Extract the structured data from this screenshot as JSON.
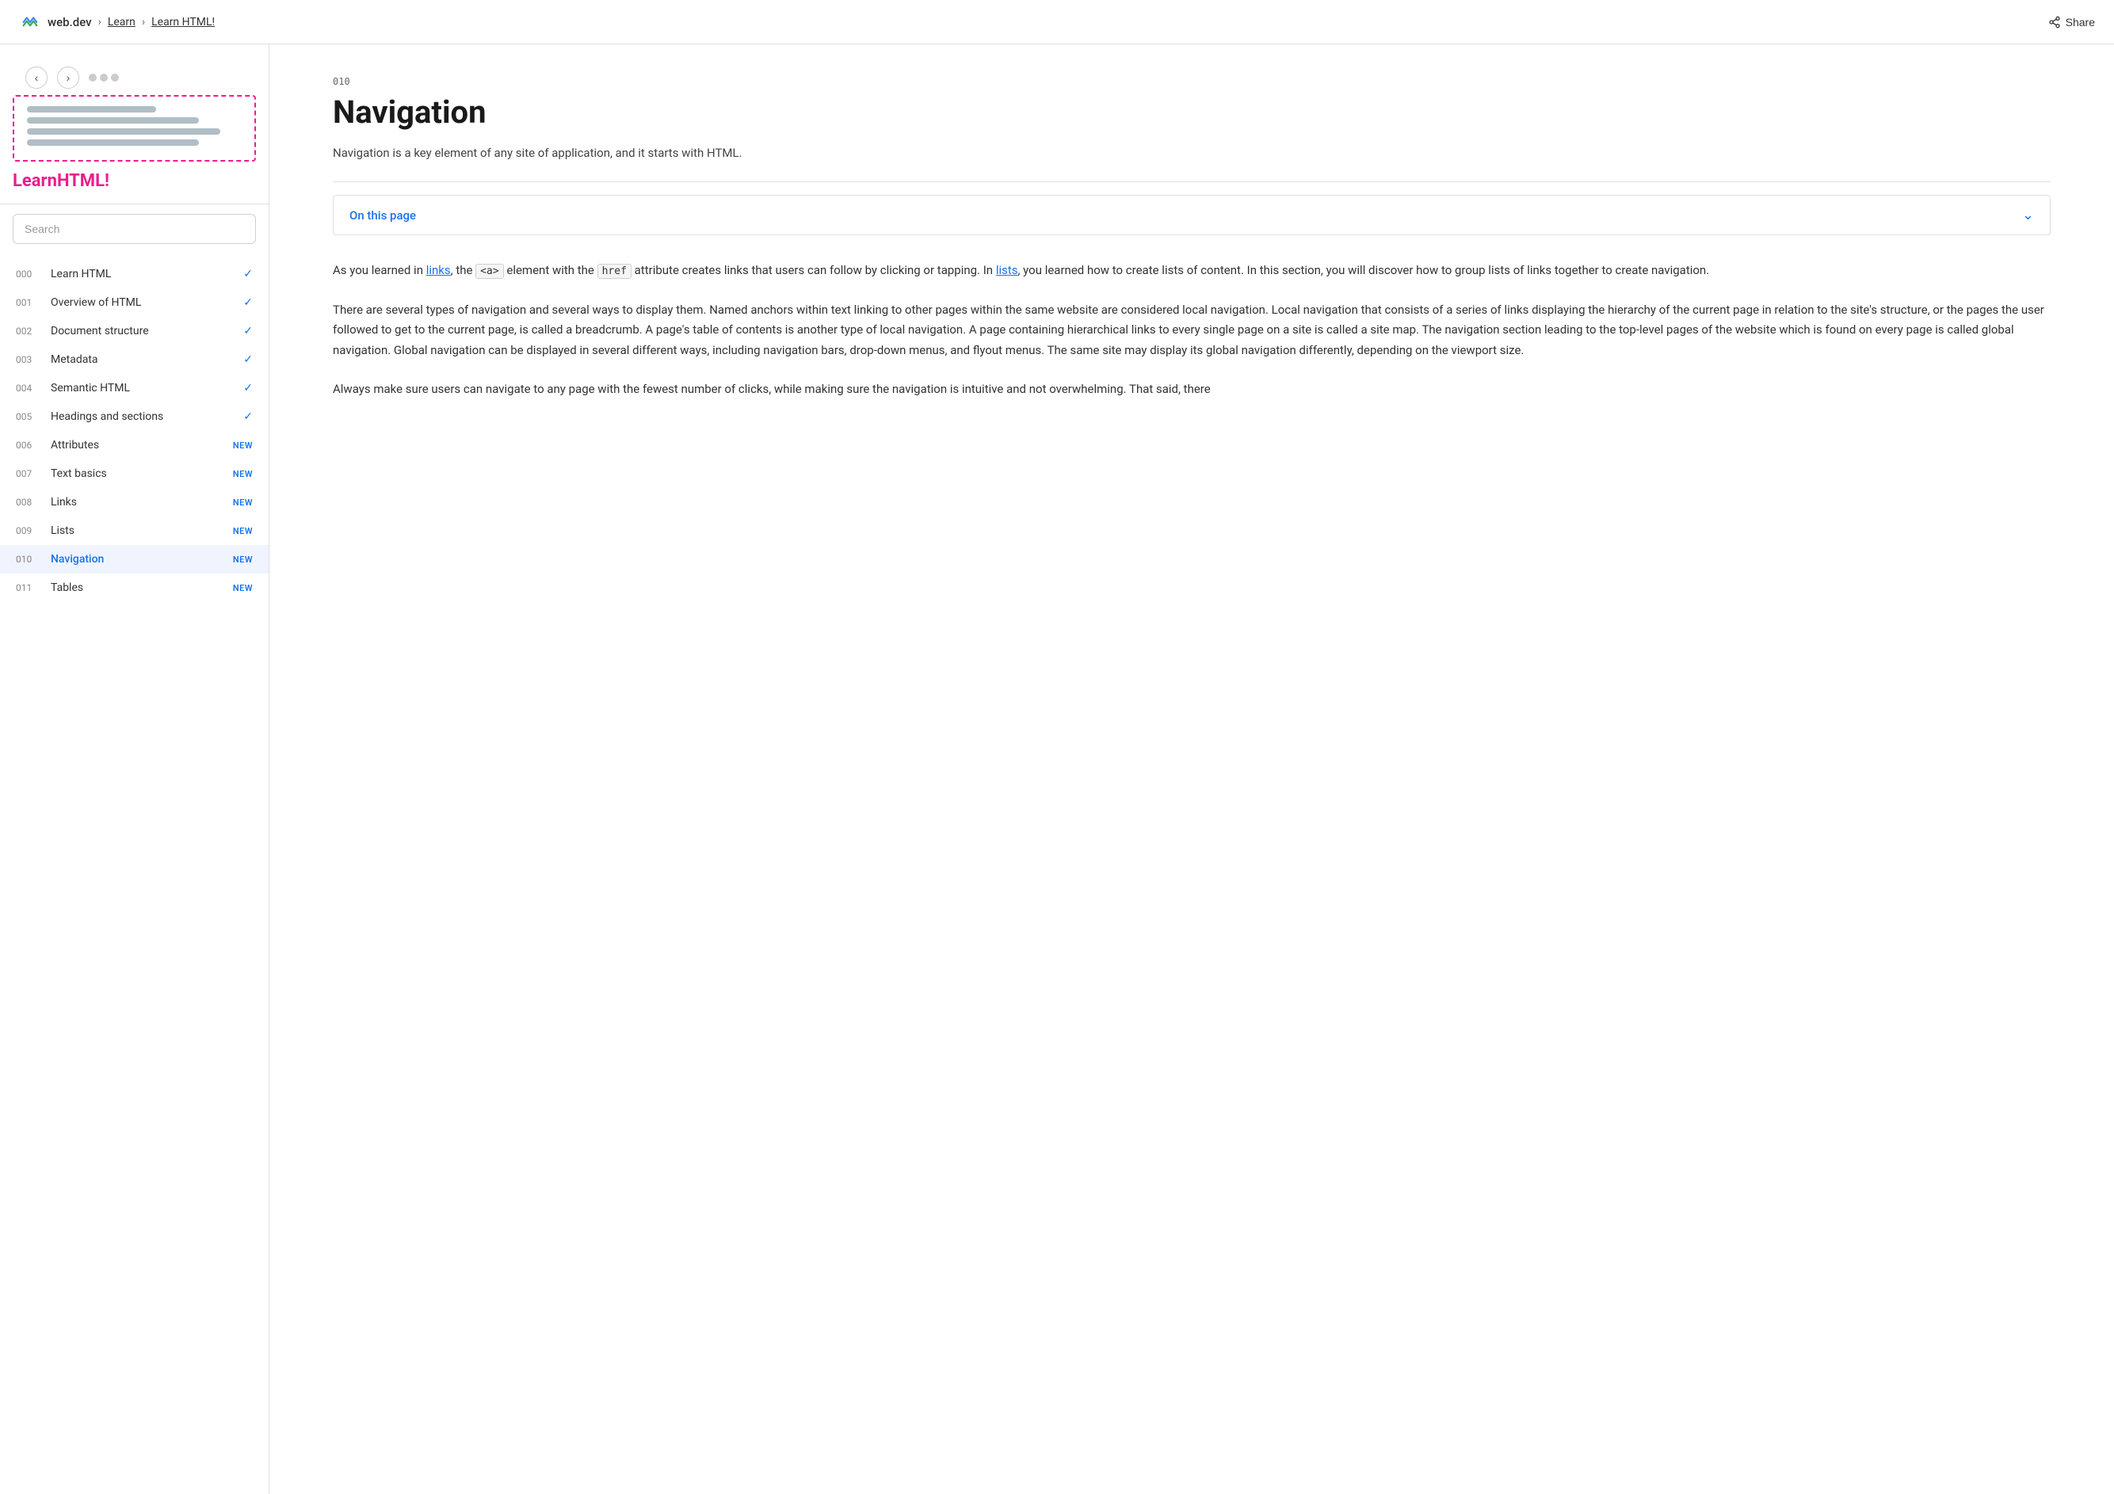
{
  "topbar": {
    "logo_text": "web.dev",
    "breadcrumbs": [
      "Learn",
      "Learn HTML!"
    ],
    "share_label": "Share"
  },
  "sidebar": {
    "title_plain": "Learn",
    "title_colored": "HTML!",
    "search_placeholder": "Search",
    "nav_items": [
      {
        "num": "000",
        "label": "Learn HTML",
        "badge": "check"
      },
      {
        "num": "001",
        "label": "Overview of HTML",
        "badge": "check"
      },
      {
        "num": "002",
        "label": "Document structure",
        "badge": "check"
      },
      {
        "num": "003",
        "label": "Metadata",
        "badge": "check"
      },
      {
        "num": "004",
        "label": "Semantic HTML",
        "badge": "check"
      },
      {
        "num": "005",
        "label": "Headings and sections",
        "badge": "check"
      },
      {
        "num": "006",
        "label": "Attributes",
        "badge": "new"
      },
      {
        "num": "007",
        "label": "Text basics",
        "badge": "new"
      },
      {
        "num": "008",
        "label": "Links",
        "badge": "new"
      },
      {
        "num": "009",
        "label": "Lists",
        "badge": "new"
      },
      {
        "num": "010",
        "label": "Navigation",
        "badge": "new",
        "active": true
      },
      {
        "num": "011",
        "label": "Tables",
        "badge": "new"
      }
    ]
  },
  "content": {
    "num": "010",
    "title": "Navigation",
    "intro": "Navigation is a key element of any site of application, and it starts with HTML.",
    "on_this_page": "On this page",
    "paragraphs": [
      "As you learned in links, the <a> element with the href attribute creates links that users can follow by clicking or tapping. In lists, you learned how to create lists of content. In this section, you will discover how to group lists of links together to create navigation.",
      "There are several types of navigation and several ways to display them. Named anchors within text linking to other pages within the same website are considered local navigation. Local navigation that consists of a series of links displaying the hierarchy of the current page in relation to the site's structure, or the pages the user followed to get to the current page, is called a breadcrumb. A page's table of contents is another type of local navigation. A page containing hierarchical links to every single page on a site is called a site map. The navigation section leading to the top-level pages of the website which is found on every page is called global navigation. Global navigation can be displayed in several different ways, including navigation bars, drop-down menus, and flyout menus. The same site may display its global navigation differently, depending on the viewport size.",
      "Always make sure users can navigate to any page with the fewest number of clicks, while making sure the navigation is intuitive and not overwhelming. That said, there"
    ],
    "inline_elements": [
      {
        "text": "links",
        "type": "link"
      },
      {
        "text": "<a>",
        "type": "code"
      },
      {
        "text": "href",
        "type": "code"
      },
      {
        "text": "lists",
        "type": "link"
      }
    ]
  }
}
